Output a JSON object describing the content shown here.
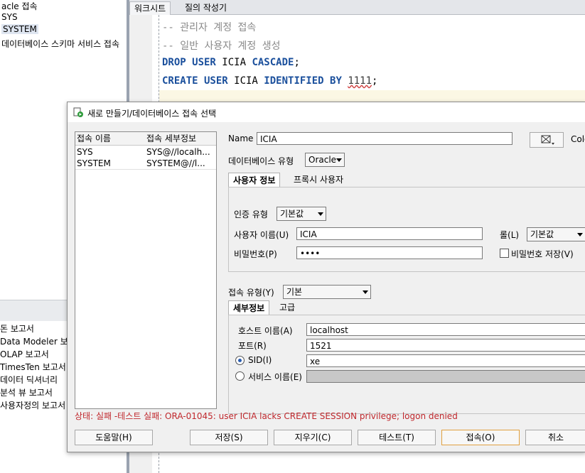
{
  "navigator": {
    "top_items": [
      "acle 접속",
      "SYS",
      "SYSTEM",
      "데이터베이스 스키마 서비스 접속"
    ],
    "bottom_items": [
      "돈 보고서",
      "Data Modeler 보고",
      "OLAP 보고서",
      "TimesTen 보고서",
      "데이터 딕셔너리",
      "분석 뷰 보고서",
      "사용자정의 보고서"
    ]
  },
  "editor": {
    "tabs": [
      "워크시트",
      "질의 작성기"
    ],
    "line1": "-- 관리자 계정 접속",
    "line2": "-- 일반 사용자 계정 생성",
    "line3_kw1": "DROP USER",
    "line3_id": " ICIA ",
    "line3_kw2": "CASCADE",
    "line3_end": ";",
    "line4_kw1": "CREATE USER",
    "line4_id": " ICIA ",
    "line4_kw2": "IDENTIFIED BY",
    "line4_num": "1111",
    "line4_end": ";"
  },
  "dialog": {
    "title": "새로 만들기/데이터베이스 접속 선택",
    "list": {
      "col_name": "접속 이름",
      "col_detail": "접속 세부정보",
      "rows": [
        {
          "name": "SYS",
          "detail": "SYS@//localh..."
        },
        {
          "name": "SYSTEM",
          "detail": "SYSTEM@//l..."
        }
      ]
    },
    "name_label": "Name",
    "name_value": "ICIA",
    "color_label": "Colo",
    "db_type_label": "데이터베이스 유형",
    "db_type_value": "Oracle",
    "tabs": [
      "사용자 정보",
      "프록시 사용자"
    ],
    "auth_type_label": "인증 유형",
    "auth_type_value": "기본값",
    "username_label": "사용자 이름(U)",
    "username_value": "ICIA",
    "role_label": "롤(L)",
    "role_value": "기본값",
    "password_label": "비밀번호(P)",
    "password_value": "••••",
    "save_password_label": "비밀번호 저장(V)",
    "conn_type_label": "접속 유형(Y)",
    "conn_type_value": "기본",
    "detail_tabs": [
      "세부정보",
      "고급"
    ],
    "host_label": "호스트 이름(A)",
    "host_value": "localhost",
    "port_label": "포트(R)",
    "port_value": "1521",
    "sid_label": "SID(I)",
    "sid_value": "xe",
    "service_label": "서비스 이름(E)",
    "status": "상태: 실패 -테스트 실패: ORA-01045: user ICIA lacks CREATE SESSION privilege; logon denied",
    "buttons": {
      "help": "도움말(H)",
      "save": "저장(S)",
      "clear": "지우기(C)",
      "test": "테스트(T)",
      "connect": "접속(O)",
      "cancel": "취소"
    }
  }
}
